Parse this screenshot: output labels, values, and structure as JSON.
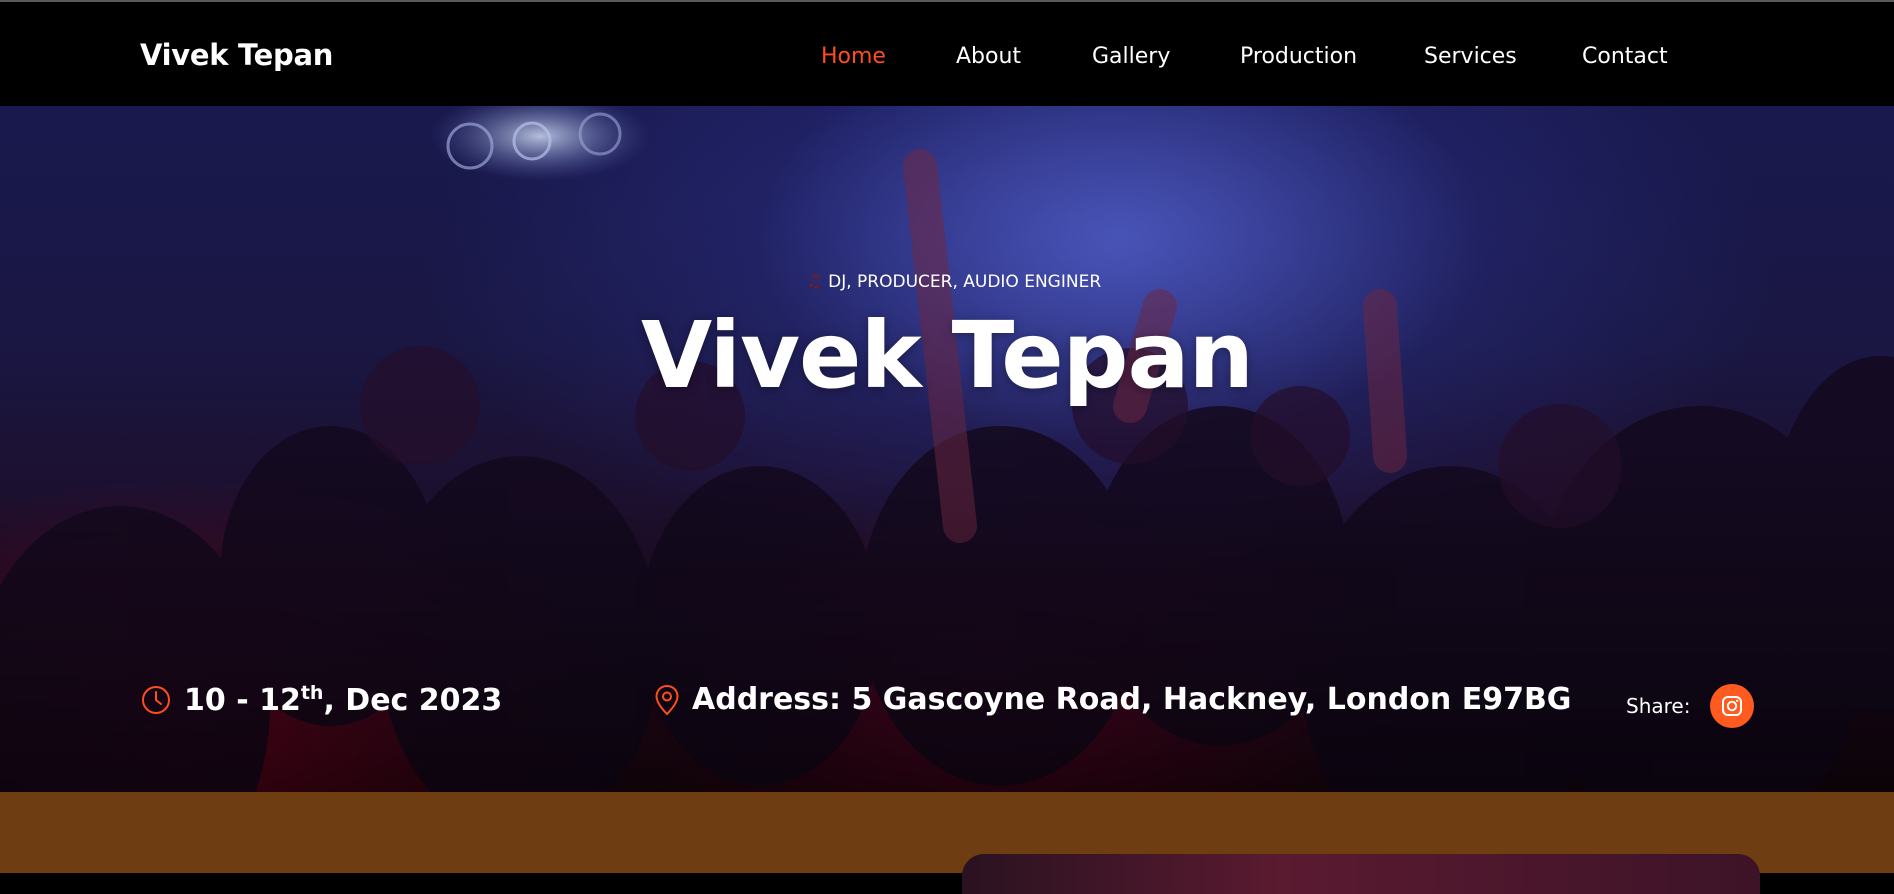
{
  "header": {
    "brand": "Vivek Tepan",
    "nav": [
      {
        "label": "Home",
        "active": true
      },
      {
        "label": "About",
        "active": false
      },
      {
        "label": "Gallery",
        "active": false
      },
      {
        "label": "Production",
        "active": false
      },
      {
        "label": "Services",
        "active": false
      },
      {
        "label": "Contact",
        "active": false
      }
    ]
  },
  "hero": {
    "tagline_icon": "music-note-icon",
    "tagline": "DJ, PRODUCER, AUDIO ENGINER",
    "title": "Vivek Tepan",
    "date": {
      "icon": "clock-icon",
      "prefix": "10 - 12",
      "sup": "th",
      "suffix": ", Dec 2023"
    },
    "address": {
      "icon": "map-pin-icon",
      "text": "Address: 5 Gascoyne Road, Hackney, London E97BG"
    },
    "share": {
      "label": "Share:",
      "icon": "instagram-icon"
    }
  },
  "colors": {
    "accent": "#ff4d1f",
    "header_bg": "#000000",
    "section_bg": "#6e3d12"
  }
}
